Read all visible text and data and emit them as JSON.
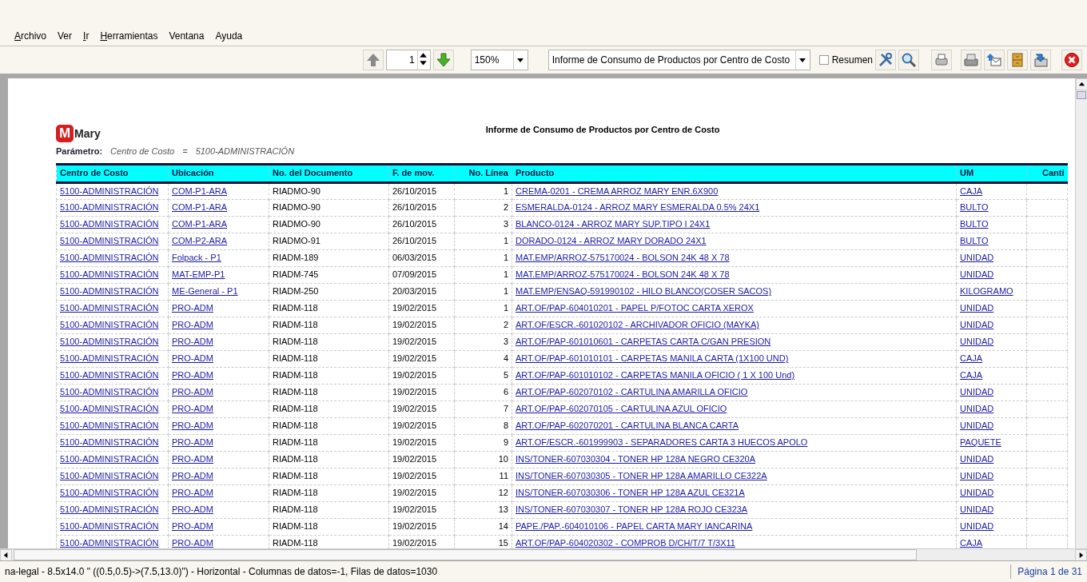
{
  "menu": [
    {
      "label": "Archivo",
      "mnemonic": true
    },
    {
      "label": "Ver",
      "mnemonic": false
    },
    {
      "label": "Ir",
      "mnemonic": true
    },
    {
      "label": "Herramientas",
      "mnemonic": true
    },
    {
      "label": "Ventana",
      "mnemonic": false
    },
    {
      "label": "Ayuda",
      "mnemonic": false
    }
  ],
  "toolbar": {
    "page": "1",
    "zoom": "150%",
    "report": "Informe de Consumo de Productos por Centro de Costo",
    "summary": {
      "label": "Resumen",
      "checked": false
    }
  },
  "report": {
    "logo": {
      "mark": "M",
      "name": "Mary"
    },
    "title": "Informe de Consumo de Productos por Centro de Costo",
    "parameter": {
      "label": "Parámetro:",
      "field": "Centro de Costo",
      "operator": "=",
      "value": "5100-ADMINISTRACIÓN"
    },
    "table": {
      "columns": [
        {
          "label": "Centro de Costo",
          "kind": "link"
        },
        {
          "label": "Ubicación",
          "kind": "link"
        },
        {
          "label": "No. del Documento",
          "kind": "text"
        },
        {
          "label": "F. de mov.",
          "kind": "text"
        },
        {
          "label": "No. Línea",
          "kind": "number"
        },
        {
          "label": "Producto",
          "kind": "link"
        },
        {
          "label": "UM",
          "kind": "link"
        },
        {
          "label": "Canti",
          "kind": "number"
        }
      ],
      "rows": [
        [
          "5100-ADMINISTRACIÓN",
          "COM-P1-ARA",
          "RIADMO-90",
          "26/10/2015",
          "1",
          "CREMA-0201  - CREMA ARROZ MARY ENR.6X900",
          "CAJA"
        ],
        [
          "5100-ADMINISTRACIÓN",
          "COM-P1-ARA",
          "RIADMO-90",
          "26/10/2015",
          "2",
          "ESMERALDA-0124 - ARROZ MARY ESMERALDA 0.5% 24X1",
          "BULTO"
        ],
        [
          "5100-ADMINISTRACIÓN",
          "COM-P1-ARA",
          "RIADMO-90",
          "26/10/2015",
          "3",
          "BLANCO-0124 - ARROZ MARY SUP.TIPO I 24X1",
          "BULTO"
        ],
        [
          "5100-ADMINISTRACIÓN",
          "COM-P2-ARA",
          "RIADMO-91",
          "26/10/2015",
          "1",
          "DORADO-0124 - ARROZ MARY DORADO 24X1",
          "BULTO"
        ],
        [
          "5100-ADMINISTRACIÓN",
          "Folpack - P1",
          "RIADM-189",
          "06/03/2015",
          "1",
          "MAT.EMP/ARROZ-575170024 - BOLSON 24K 48 X 78",
          "UNIDAD"
        ],
        [
          "5100-ADMINISTRACIÓN",
          "MAT-EMP-P1",
          "RIADM-745",
          "07/09/2015",
          "1",
          "MAT.EMP/ARROZ-575170024 - BOLSON 24K 48 X 78",
          "UNIDAD"
        ],
        [
          "5100-ADMINISTRACIÓN",
          "ME-General - P1",
          "RIADM-250",
          "20/03/2015",
          "1",
          "MAT.EMP/ENSAQ-591990102 - HILO BLANCO(COSER SACOS)",
          "KILOGRAMO"
        ],
        [
          "5100-ADMINISTRACIÓN",
          "PRO-ADM",
          "RIADM-118",
          "19/02/2015",
          "1",
          "ART.OF/PAP-604010201 - PAPEL P/FOTOC  CARTA  XEROX",
          "UNIDAD"
        ],
        [
          "5100-ADMINISTRACIÓN",
          "PRO-ADM",
          "RIADM-118",
          "19/02/2015",
          "2",
          "ART.OF/ESCR.-601020102 - ARCHIVADOR OFICIO (MAYKA)",
          "UNIDAD"
        ],
        [
          "5100-ADMINISTRACIÓN",
          "PRO-ADM",
          "RIADM-118",
          "19/02/2015",
          "3",
          "ART.OF/PAP-601010601 - CARPETAS CARTA C/GAN  PRESION",
          "UNIDAD"
        ],
        [
          "5100-ADMINISTRACIÓN",
          "PRO-ADM",
          "RIADM-118",
          "19/02/2015",
          "4",
          "ART.OF/PAP-601010101 - CARPETAS MANILA CARTA (1X100 UND)",
          "CAJA"
        ],
        [
          "5100-ADMINISTRACIÓN",
          "PRO-ADM",
          "RIADM-118",
          "19/02/2015",
          "5",
          "ART.OF/PAP-601010102 - CARPETAS MANILA OFICIO ( 1 X 100 Und)",
          "CAJA"
        ],
        [
          "5100-ADMINISTRACIÓN",
          "PRO-ADM",
          "RIADM-118",
          "19/02/2015",
          "6",
          "ART.OF/PAP-602070102 - CARTULINA AMARILLA OFICIO",
          "UNIDAD"
        ],
        [
          "5100-ADMINISTRACIÓN",
          "PRO-ADM",
          "RIADM-118",
          "19/02/2015",
          "7",
          "ART.OF/PAP-602070105 - CARTULINA AZUL OFICIO",
          "UNIDAD"
        ],
        [
          "5100-ADMINISTRACIÓN",
          "PRO-ADM",
          "RIADM-118",
          "19/02/2015",
          "8",
          "ART.OF/PAP-602070201 - CARTULINA BLANCA CARTA",
          "UNIDAD"
        ],
        [
          "5100-ADMINISTRACIÓN",
          "PRO-ADM",
          "RIADM-118",
          "19/02/2015",
          "9",
          "ART.OF/ESCR.-601999903 - SEPARADORES CARTA 3 HUECOS APOLO",
          "PAQUETE"
        ],
        [
          "5100-ADMINISTRACIÓN",
          "PRO-ADM",
          "RIADM-118",
          "19/02/2015",
          "10",
          "INS/TONER-607030304 - TONER HP 128A  NEGRO CE320A",
          "UNIDAD"
        ],
        [
          "5100-ADMINISTRACIÓN",
          "PRO-ADM",
          "RIADM-118",
          "19/02/2015",
          "11",
          "INS/TONER-607030305 - TONER HP 128A  AMARILLO CE322A",
          "UNIDAD"
        ],
        [
          "5100-ADMINISTRACIÓN",
          "PRO-ADM",
          "RIADM-118",
          "19/02/2015",
          "12",
          "INS/TONER-607030306 - TONER HP 128A  AZUL CE321A",
          "UNIDAD"
        ],
        [
          "5100-ADMINISTRACIÓN",
          "PRO-ADM",
          "RIADM-118",
          "19/02/2015",
          "13",
          "INS/TONER-607030307 - TONER HP 128A  ROJO CE323A",
          "UNIDAD"
        ],
        [
          "5100-ADMINISTRACIÓN",
          "PRO-ADM",
          "RIADM-118",
          "19/02/2015",
          "14",
          "PAPE./PAP.-604010106 - PAPEL CARTA MARY IANCARINA",
          "UNIDAD"
        ],
        [
          "5100-ADMINISTRACIÓN",
          "PRO-ADM",
          "RIADM-118",
          "19/02/2015",
          "15",
          "ART.OF/PAP-604020302 - COMPROB D/CH/T/7 T/3X11",
          "CAJA"
        ]
      ]
    }
  },
  "status_bar": {
    "info": "na-legal - 8.5x14.0 \" ((0.5,0.5)->(7.5,13.0)\") - Horizontal - Columnas de datos=-1, Filas de datos=1030",
    "page": "Página 1 de 31"
  }
}
